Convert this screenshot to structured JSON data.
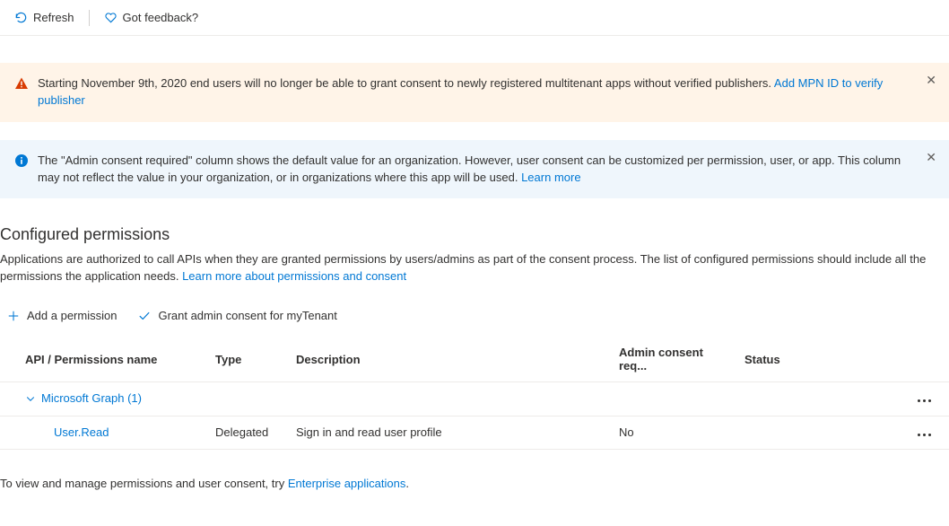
{
  "toolbar": {
    "refresh_label": "Refresh",
    "feedback_label": "Got feedback?"
  },
  "banners": {
    "warning": {
      "text": "Starting November 9th, 2020 end users will no longer be able to grant consent to newly registered multitenant apps without verified publishers. ",
      "link": "Add MPN ID to verify publisher"
    },
    "info": {
      "text": "The \"Admin consent required\" column shows the default value for an organization. However, user consent can be customized per permission, user, or app. This column may not reflect the value in your organization, or in organizations where this app will be used. ",
      "link": "Learn more"
    }
  },
  "section": {
    "title": "Configured permissions",
    "desc": "Applications are authorized to call APIs when they are granted permissions by users/admins as part of the consent process. The list of configured permissions should include all the permissions the application needs. ",
    "desc_link": "Learn more about permissions and consent"
  },
  "actions": {
    "add_permission": "Add a permission",
    "grant_consent": "Grant admin consent for myTenant"
  },
  "table": {
    "headers": {
      "name": "API / Permissions name",
      "type": "Type",
      "description": "Description",
      "consent": "Admin consent req...",
      "status": "Status"
    },
    "group": {
      "label": "Microsoft Graph (1)"
    },
    "row": {
      "name": "User.Read",
      "type": "Delegated",
      "description": "Sign in and read user profile",
      "consent": "No",
      "status": ""
    }
  },
  "footer": {
    "text": "To view and manage permissions and user consent, try ",
    "link": "Enterprise applications",
    "period": "."
  }
}
